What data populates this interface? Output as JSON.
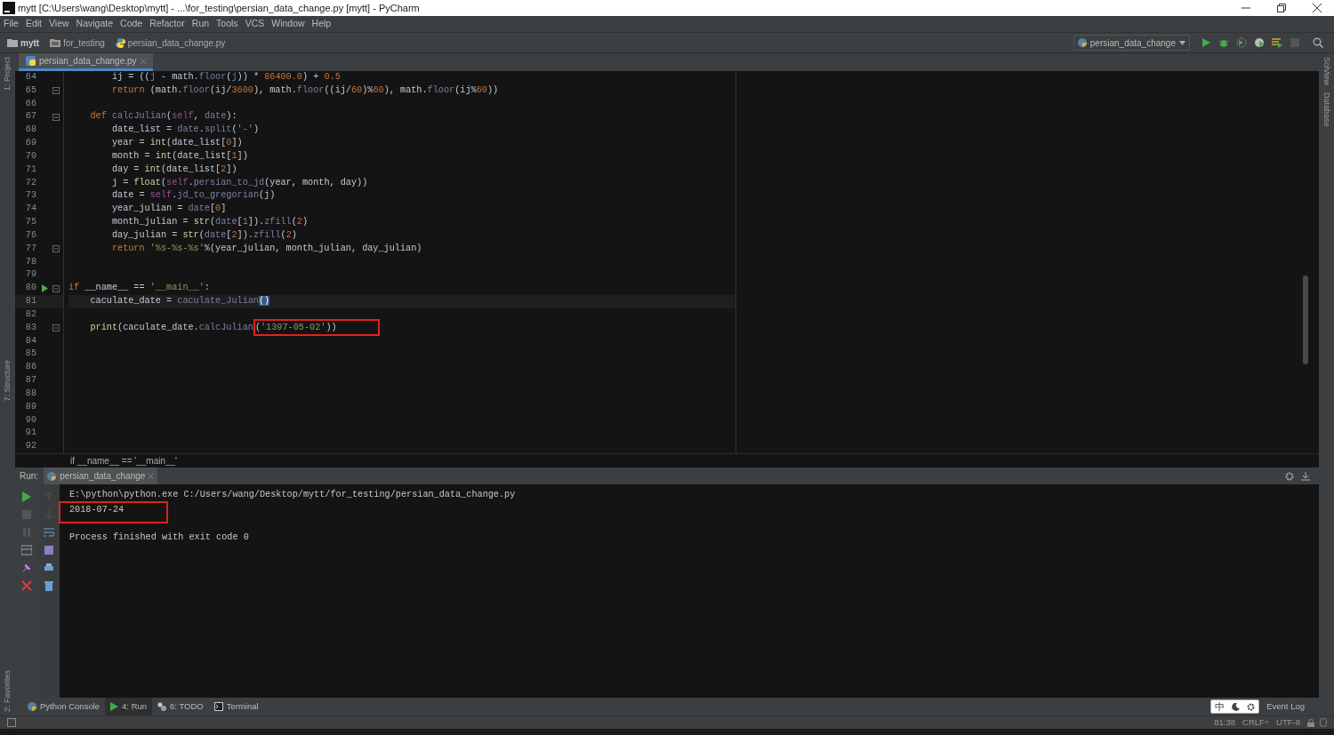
{
  "window": {
    "title": "mytt [C:\\Users\\wang\\Desktop\\mytt] - ...\\for_testing\\persian_data_change.py [mytt] - PyCharm"
  },
  "menu": [
    "File",
    "Edit",
    "View",
    "Navigate",
    "Code",
    "Refactor",
    "Run",
    "Tools",
    "VCS",
    "Window",
    "Help"
  ],
  "breadcrumb": [
    {
      "kind": "project",
      "text": "mytt"
    },
    {
      "kind": "folder",
      "text": "for_testing"
    },
    {
      "kind": "file",
      "text": "persian_data_change.py"
    }
  ],
  "run_config": "persian_data_change",
  "left_strip": [
    "1: Project",
    "7: Structure",
    "2: Favorites"
  ],
  "right_strip": [
    "SciView",
    "Database"
  ],
  "editor_tab": "persian_data_change.py",
  "editor": {
    "lines": [
      {
        "number": "64",
        "tokens": [
          {
            "kind": "plain",
            "text": "        ij = (("
          },
          {
            "kind": "call",
            "text": "j"
          },
          {
            "kind": "plain",
            "text": " - math."
          },
          {
            "kind": "call",
            "text": "floor"
          },
          {
            "kind": "plain",
            "text": "("
          },
          {
            "kind": "call",
            "text": "j"
          },
          {
            "kind": "plain",
            "text": ")) * "
          },
          {
            "kind": "num",
            "text": "86400.0"
          },
          {
            "kind": "plain",
            "text": ") + "
          },
          {
            "kind": "num",
            "text": "0.5"
          }
        ]
      },
      {
        "number": "65",
        "fold": true,
        "tokens": [
          {
            "kind": "kw",
            "text": "        return "
          },
          {
            "kind": "plain",
            "text": "(math."
          },
          {
            "kind": "call",
            "text": "floor"
          },
          {
            "kind": "plain",
            "text": "(ij/"
          },
          {
            "kind": "num",
            "text": "3600"
          },
          {
            "kind": "plain",
            "text": "), math."
          },
          {
            "kind": "call",
            "text": "floor"
          },
          {
            "kind": "plain",
            "text": "((ij/"
          },
          {
            "kind": "num",
            "text": "60"
          },
          {
            "kind": "plain",
            "text": ")%"
          },
          {
            "kind": "num",
            "text": "60"
          },
          {
            "kind": "plain",
            "text": "), math."
          },
          {
            "kind": "call",
            "text": "floor"
          },
          {
            "kind": "plain",
            "text": "(ij%"
          },
          {
            "kind": "num",
            "text": "60"
          },
          {
            "kind": "plain",
            "text": "))"
          }
        ]
      },
      {
        "number": "66"
      },
      {
        "number": "67",
        "fold": true,
        "tokens": [
          {
            "kind": "kw",
            "text": "    def "
          },
          {
            "kind": "call",
            "text": "calcJulian"
          },
          {
            "kind": "plain",
            "text": "("
          },
          {
            "kind": "self",
            "text": "self"
          },
          {
            "kind": "plain",
            "text": ", "
          },
          {
            "kind": "call",
            "text": "date"
          },
          {
            "kind": "plain",
            "text": "):"
          }
        ]
      },
      {
        "number": "68",
        "tokens": [
          {
            "kind": "plain",
            "text": "        date_list = "
          },
          {
            "kind": "call",
            "text": "date"
          },
          {
            "kind": "plain",
            "text": "."
          },
          {
            "kind": "call",
            "text": "split"
          },
          {
            "kind": "plain",
            "text": "("
          },
          {
            "kind": "str",
            "text": "'-'"
          },
          {
            "kind": "plain",
            "text": ")"
          }
        ]
      },
      {
        "number": "69",
        "tokens": [
          {
            "kind": "plain",
            "text": "        year = "
          },
          {
            "kind": "builtin",
            "text": "int"
          },
          {
            "kind": "plain",
            "text": "(date_list["
          },
          {
            "kind": "num",
            "text": "0"
          },
          {
            "kind": "plain",
            "text": "])"
          }
        ]
      },
      {
        "number": "70",
        "tokens": [
          {
            "kind": "plain",
            "text": "        month = "
          },
          {
            "kind": "builtin",
            "text": "int"
          },
          {
            "kind": "plain",
            "text": "(date_list["
          },
          {
            "kind": "num",
            "text": "1"
          },
          {
            "kind": "plain",
            "text": "])"
          }
        ]
      },
      {
        "number": "71",
        "tokens": [
          {
            "kind": "plain",
            "text": "        day = "
          },
          {
            "kind": "builtin",
            "text": "int"
          },
          {
            "kind": "plain",
            "text": "(date_list["
          },
          {
            "kind": "num",
            "text": "2"
          },
          {
            "kind": "plain",
            "text": "])"
          }
        ]
      },
      {
        "number": "72",
        "tokens": [
          {
            "kind": "plain",
            "text": "        j = "
          },
          {
            "kind": "builtin",
            "text": "float"
          },
          {
            "kind": "plain",
            "text": "("
          },
          {
            "kind": "self",
            "text": "self"
          },
          {
            "kind": "plain",
            "text": "."
          },
          {
            "kind": "call",
            "text": "persian_to_jd"
          },
          {
            "kind": "plain",
            "text": "(year, month, day))"
          }
        ]
      },
      {
        "number": "73",
        "tokens": [
          {
            "kind": "plain",
            "text": "        date = "
          },
          {
            "kind": "self",
            "text": "self"
          },
          {
            "kind": "plain",
            "text": "."
          },
          {
            "kind": "call",
            "text": "jd_to_gregorian"
          },
          {
            "kind": "plain",
            "text": "(j)"
          }
        ]
      },
      {
        "number": "74",
        "tokens": [
          {
            "kind": "plain",
            "text": "        year_julian = "
          },
          {
            "kind": "call",
            "text": "date"
          },
          {
            "kind": "plain",
            "text": "["
          },
          {
            "kind": "num",
            "text": "0"
          },
          {
            "kind": "plain",
            "text": "]"
          }
        ]
      },
      {
        "number": "75",
        "tokens": [
          {
            "kind": "plain",
            "text": "        month_julian = "
          },
          {
            "kind": "builtin",
            "text": "str"
          },
          {
            "kind": "plain",
            "text": "("
          },
          {
            "kind": "call",
            "text": "date"
          },
          {
            "kind": "plain",
            "text": "["
          },
          {
            "kind": "num",
            "text": "1"
          },
          {
            "kind": "plain",
            "text": "])."
          },
          {
            "kind": "call",
            "text": "zfill"
          },
          {
            "kind": "plain",
            "text": "("
          },
          {
            "kind": "num",
            "text": "2"
          },
          {
            "kind": "plain",
            "text": ")"
          }
        ]
      },
      {
        "number": "76",
        "tokens": [
          {
            "kind": "plain",
            "text": "        day_julian = "
          },
          {
            "kind": "builtin",
            "text": "str"
          },
          {
            "kind": "plain",
            "text": "("
          },
          {
            "kind": "call",
            "text": "date"
          },
          {
            "kind": "plain",
            "text": "["
          },
          {
            "kind": "num",
            "text": "2"
          },
          {
            "kind": "plain",
            "text": "])."
          },
          {
            "kind": "call",
            "text": "zfill"
          },
          {
            "kind": "plain",
            "text": "("
          },
          {
            "kind": "num",
            "text": "2"
          },
          {
            "kind": "plain",
            "text": ")"
          }
        ]
      },
      {
        "number": "77",
        "fold": true,
        "tokens": [
          {
            "kind": "kw",
            "text": "        return "
          },
          {
            "kind": "str",
            "text": "'%s-%s-%s'"
          },
          {
            "kind": "plain",
            "text": "%(year_julian, month_julian, day_julian)"
          }
        ]
      },
      {
        "number": "78"
      },
      {
        "number": "79"
      },
      {
        "number": "80",
        "fold": true,
        "run_marker": true,
        "tokens": [
          {
            "kind": "kw",
            "text": "if "
          },
          {
            "kind": "plain",
            "text": "__name__ == "
          },
          {
            "kind": "str",
            "text": "'__main__'"
          },
          {
            "kind": "plain",
            "text": ":"
          }
        ]
      },
      {
        "number": "81",
        "current": true,
        "tokens": [
          {
            "kind": "plain",
            "text": "    caculate_date = "
          },
          {
            "kind": "call",
            "text": "caculate_Julian"
          },
          {
            "kind": "match",
            "text": "()"
          }
        ]
      },
      {
        "number": "82"
      },
      {
        "number": "83",
        "fold": true,
        "tokens": [
          {
            "kind": "builtin",
            "text": "    print"
          },
          {
            "kind": "plain",
            "text": "(caculate_date."
          },
          {
            "kind": "call",
            "text": "calcJulian"
          },
          {
            "kind": "plain",
            "text": "(",
            "boxed": true
          },
          {
            "kind": "str",
            "text": "'1397-05-02'",
            "boxed": true
          },
          {
            "kind": "plain",
            "text": "))",
            "boxed": true
          }
        ]
      },
      {
        "number": "84"
      },
      {
        "number": "85"
      },
      {
        "number": "86"
      },
      {
        "number": "87"
      },
      {
        "number": "88"
      },
      {
        "number": "89"
      },
      {
        "number": "90"
      },
      {
        "number": "91"
      },
      {
        "number": "92"
      }
    ],
    "breadcrumb": "if __name__ == '__main__'"
  },
  "run_panel": {
    "label": "Run:",
    "tab": "persian_data_change",
    "output": [
      {
        "kind": "command",
        "text": "E:\\python\\python.exe C:/Users/wang/Desktop/mytt/for_testing/persian_data_change.py"
      },
      {
        "kind": "result",
        "text": "2018-07-24"
      },
      {
        "kind": "exit",
        "text": "Process finished with exit code 0"
      }
    ]
  },
  "tool_tabs": [
    {
      "kind": "console",
      "label": "Python Console",
      "selected": false
    },
    {
      "kind": "run",
      "label": "4: Run",
      "selected": true
    },
    {
      "kind": "todo",
      "label": "6: TODO",
      "selected": false
    },
    {
      "kind": "terminal",
      "label": "Terminal",
      "selected": false
    }
  ],
  "ime": "中",
  "event_log": "Event Log",
  "status": {
    "position": "81:38",
    "line_separator": "CRLF÷",
    "encoding": "UTF-8"
  }
}
